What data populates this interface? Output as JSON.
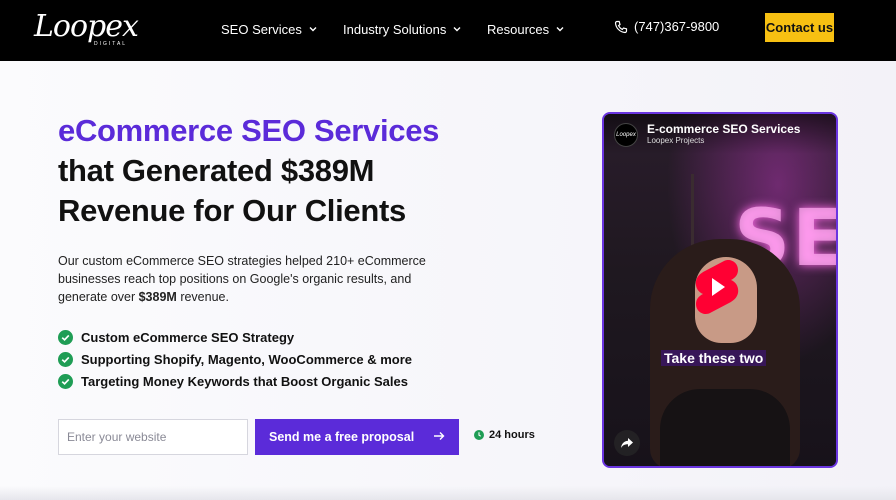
{
  "nav": {
    "logo_text": "Loopex",
    "logo_sub": "DIGITAL",
    "items": [
      {
        "label": "SEO Services"
      },
      {
        "label": "Industry Solutions"
      },
      {
        "label": "Resources"
      }
    ],
    "phone": "(747)367-9800",
    "contact_label": "Contact us"
  },
  "hero": {
    "title_line1": "eCommerce SEO Services",
    "title_line2": "that Generated $389M",
    "title_line3": "Revenue for Our Clients",
    "desc_prefix": "Our custom eCommerce SEO strategies helped 210+ eCommerce businesses reach top positions on Google's organic results, and generate over ",
    "desc_bold": "$389M",
    "desc_suffix": " revenue.",
    "features": [
      "Custom eCommerce SEO Strategy",
      "Supporting Shopify, Magento, WooCommerce & more",
      "Targeting Money Keywords that Boost Organic Sales"
    ],
    "input_placeholder": "Enter your website",
    "cta_label": "Send me a free proposal",
    "turnaround": "24 hours"
  },
  "video": {
    "title": "E-commerce SEO Services",
    "channel": "Loopex Projects",
    "avatar_text": "Loopex",
    "caption": "Take these two",
    "neon_text": "SE"
  },
  "colors": {
    "accent": "#5b2bd9",
    "cta_yellow": "#f7c012",
    "check_green": "#1f9d55",
    "youtube_red": "#ff0033"
  }
}
